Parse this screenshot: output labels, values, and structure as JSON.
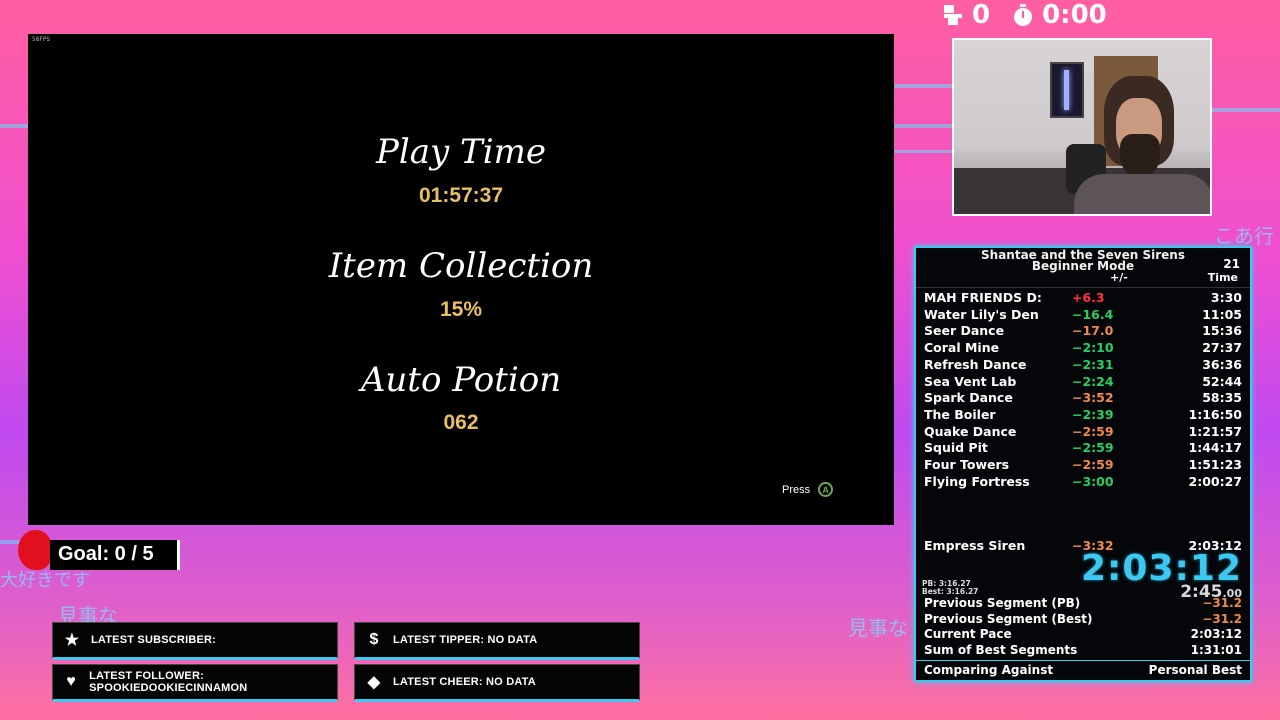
{
  "top_stats": {
    "deaths": "0",
    "timer": "0:00"
  },
  "game": {
    "fps": "58FPS",
    "stats": [
      {
        "title": "Play Time",
        "value": "01:57:37"
      },
      {
        "title": "Item Collection",
        "value": "15%"
      },
      {
        "title": "Auto Potion",
        "value": "062"
      }
    ],
    "press_label": "Press",
    "press_button": "A"
  },
  "overlay_text": {
    "jp1": "こあ行こ",
    "jp2": "大好きです",
    "jp3": "見事な",
    "jp4": "見事な"
  },
  "splits": {
    "game_title": "Shantae and the Seven Sirens",
    "category": "Beginner Mode",
    "attempts": "21",
    "col_delta": "+/-",
    "col_time": "Time",
    "rows": [
      {
        "name": "MAH FRIENDS D:",
        "delta": "+6.3",
        "time": "3:30",
        "state": "pos"
      },
      {
        "name": "Water Lily's Den",
        "delta": "−16.4",
        "time": "11:05",
        "state": "neg"
      },
      {
        "name": "Seer Dance",
        "delta": "−17.0",
        "time": "15:36",
        "state": "negbad"
      },
      {
        "name": "Coral Mine",
        "delta": "−2:10",
        "time": "27:37",
        "state": "neg"
      },
      {
        "name": "Refresh Dance",
        "delta": "−2:31",
        "time": "36:36",
        "state": "neg"
      },
      {
        "name": "Sea Vent Lab",
        "delta": "−2:24",
        "time": "52:44",
        "state": "neg"
      },
      {
        "name": "Spark Dance",
        "delta": "−3:52",
        "time": "58:35",
        "state": "negbad"
      },
      {
        "name": "The Boiler",
        "delta": "−2:39",
        "time": "1:16:50",
        "state": "neg"
      },
      {
        "name": "Quake Dance",
        "delta": "−2:59",
        "time": "1:21:57",
        "state": "negbad"
      },
      {
        "name": "Squid Pit",
        "delta": "−2:59",
        "time": "1:44:17",
        "state": "neg"
      },
      {
        "name": "Four Towers",
        "delta": "−2:59",
        "time": "1:51:23",
        "state": "negbad"
      },
      {
        "name": "Flying Fortress",
        "delta": "−3:00",
        "time": "2:00:27",
        "state": "neg"
      }
    ],
    "final": {
      "name": "Empress Siren",
      "delta": "−3:32",
      "time": "2:03:12",
      "state": "negbad"
    },
    "big_timer": "2:03:12",
    "segment_timer": "2:45",
    "segment_timer_ms": ".00",
    "pb_label": "PB:   3:16.27",
    "best_label": "Best: 3:16.27",
    "info": [
      {
        "label": "Previous Segment (PB)",
        "value": "−31.2",
        "state": "negbad"
      },
      {
        "label": "Previous Segment (Best)",
        "value": "−31.2",
        "state": "negbad"
      },
      {
        "label": "Current Pace",
        "value": "2:03:12",
        "state": ""
      },
      {
        "label": "Sum of Best Segments",
        "value": "1:31:01",
        "state": ""
      }
    ],
    "footer_label": "Comparing Against",
    "footer_value": "Personal Best"
  },
  "goal": {
    "text": "Goal: 0 / 5"
  },
  "alerts": {
    "subscriber": "LATEST SUBSCRIBER:",
    "tipper": "LATEST TIPPER: NO DATA",
    "follower": "LATEST FOLLOWER: SPOOKIEDOOKIECINNAMON",
    "cheer": "LATEST CHEER: NO DATA"
  },
  "colors": {
    "accent": "#3ec8f0",
    "gold": "#e8c060",
    "ahead": "#25d060",
    "ahead_losing": "#f08a4a",
    "behind": "#ff3040"
  }
}
